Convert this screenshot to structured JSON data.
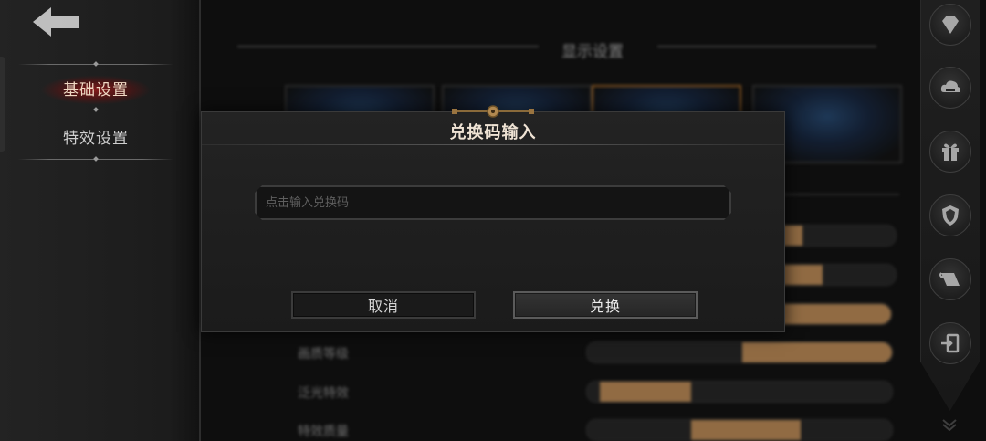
{
  "sidebar": {
    "items": [
      {
        "label": "基础设置",
        "active": true
      },
      {
        "label": "特效设置",
        "active": false
      }
    ]
  },
  "background": {
    "section_title": "显示设置",
    "row_labels": [
      "画质等级",
      "泛光特效",
      "特效质量"
    ]
  },
  "right_icons": [
    "diamond-icon",
    "cloud-save-icon",
    "gift-icon",
    "shield-icon",
    "scroll-icon",
    "logout-icon"
  ],
  "modal": {
    "title": "兑换码输入",
    "input": {
      "value": "",
      "placeholder": "点击输入兑换码"
    },
    "cancel_label": "取消",
    "confirm_label": "兑换"
  },
  "colors": {
    "accent_gold": "#c9955e",
    "active_red": "#961919",
    "title_text": "#efe3d4"
  }
}
